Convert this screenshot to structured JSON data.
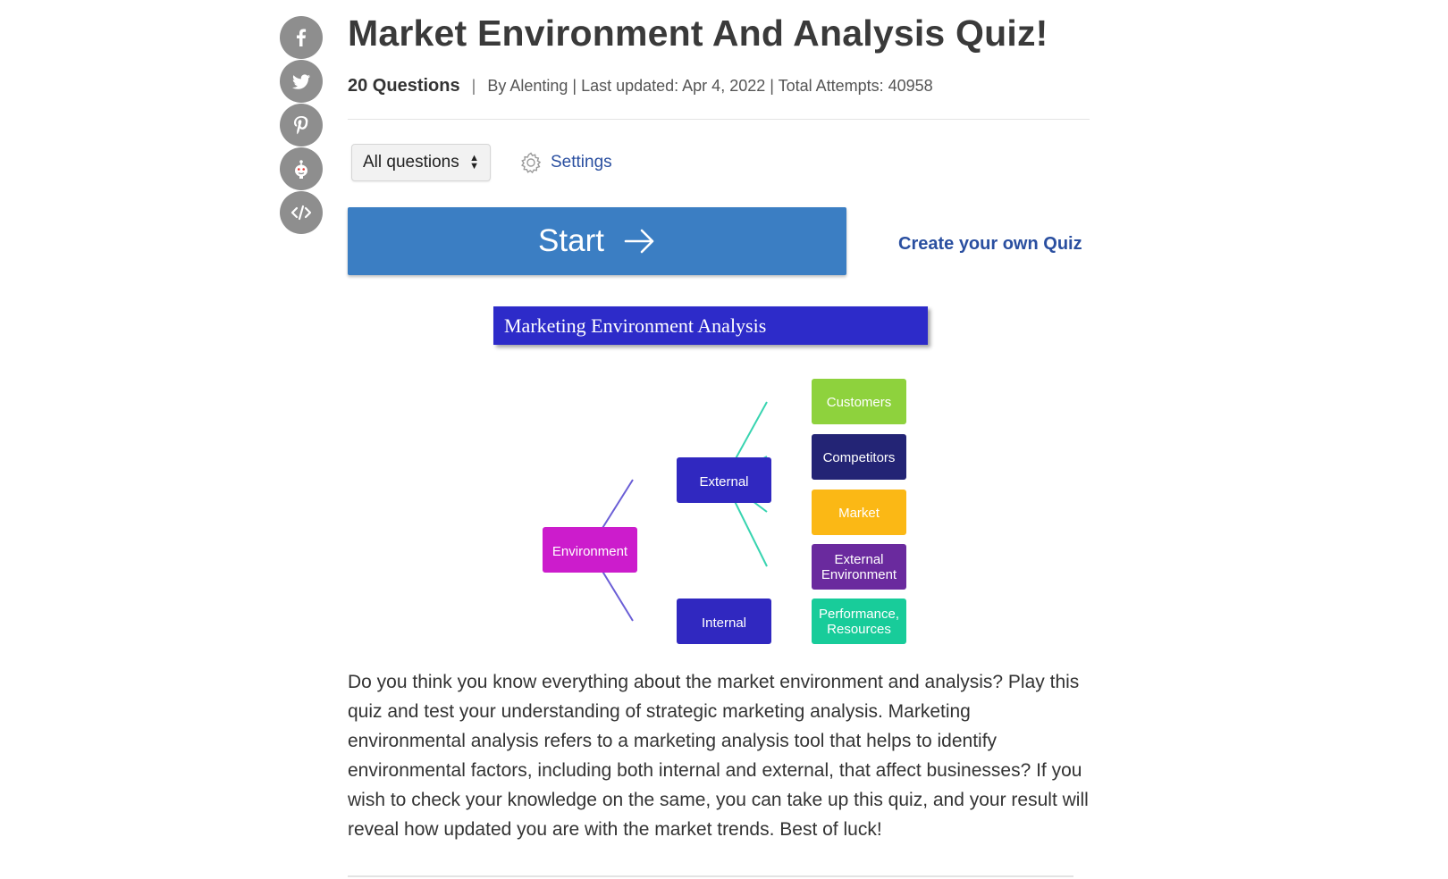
{
  "share": [
    {
      "name": "facebook-icon"
    },
    {
      "name": "twitter-icon"
    },
    {
      "name": "pinterest-icon"
    },
    {
      "name": "reddit-icon"
    },
    {
      "name": "embed-icon"
    }
  ],
  "quiz": {
    "title": "Market Environment And Analysis Quiz!",
    "question_count": "20 Questions",
    "separator": "|",
    "byline": "By Alenting | Last updated: Apr 4, 2022 | Total Attempts: 40958"
  },
  "controls": {
    "filter_value": "All questions",
    "settings_label": "Settings",
    "start_label": "Start",
    "create_label": "Create your own Quiz"
  },
  "diagram": {
    "banner": "Marketing Environment Analysis",
    "nodes": {
      "environment": "Environment",
      "external": "External",
      "internal": "Internal",
      "customers": "Customers",
      "competitors": "Competitors",
      "market": "Market",
      "external_env_1": "External",
      "external_env_2": "Environment",
      "perf_1": "Performance,",
      "perf_2": "Resources"
    },
    "colors": {
      "banner": "#2d2bc9",
      "environment": "#cc1ccc",
      "external": "#3028c0",
      "internal": "#3028c0",
      "customers": "#8ed23d",
      "competitors": "#232475",
      "market": "#fbb815",
      "external_environment": "#6a2a9e",
      "performance": "#18cc9a",
      "edge_purple": "#6a5ed6",
      "edge_teal": "#38d4b0"
    }
  },
  "description": "Do you think you know everything about the market environment and analysis? Play this quiz and test your understanding of strategic marketing analysis. Marketing environmental analysis refers to a marketing analysis tool that helps to identify environmental factors, including both internal and external, that affect businesses? If you wish to check your knowledge on the same, you can take up this quiz, and your result will reveal how updated you are with the market trends. Best of luck!"
}
